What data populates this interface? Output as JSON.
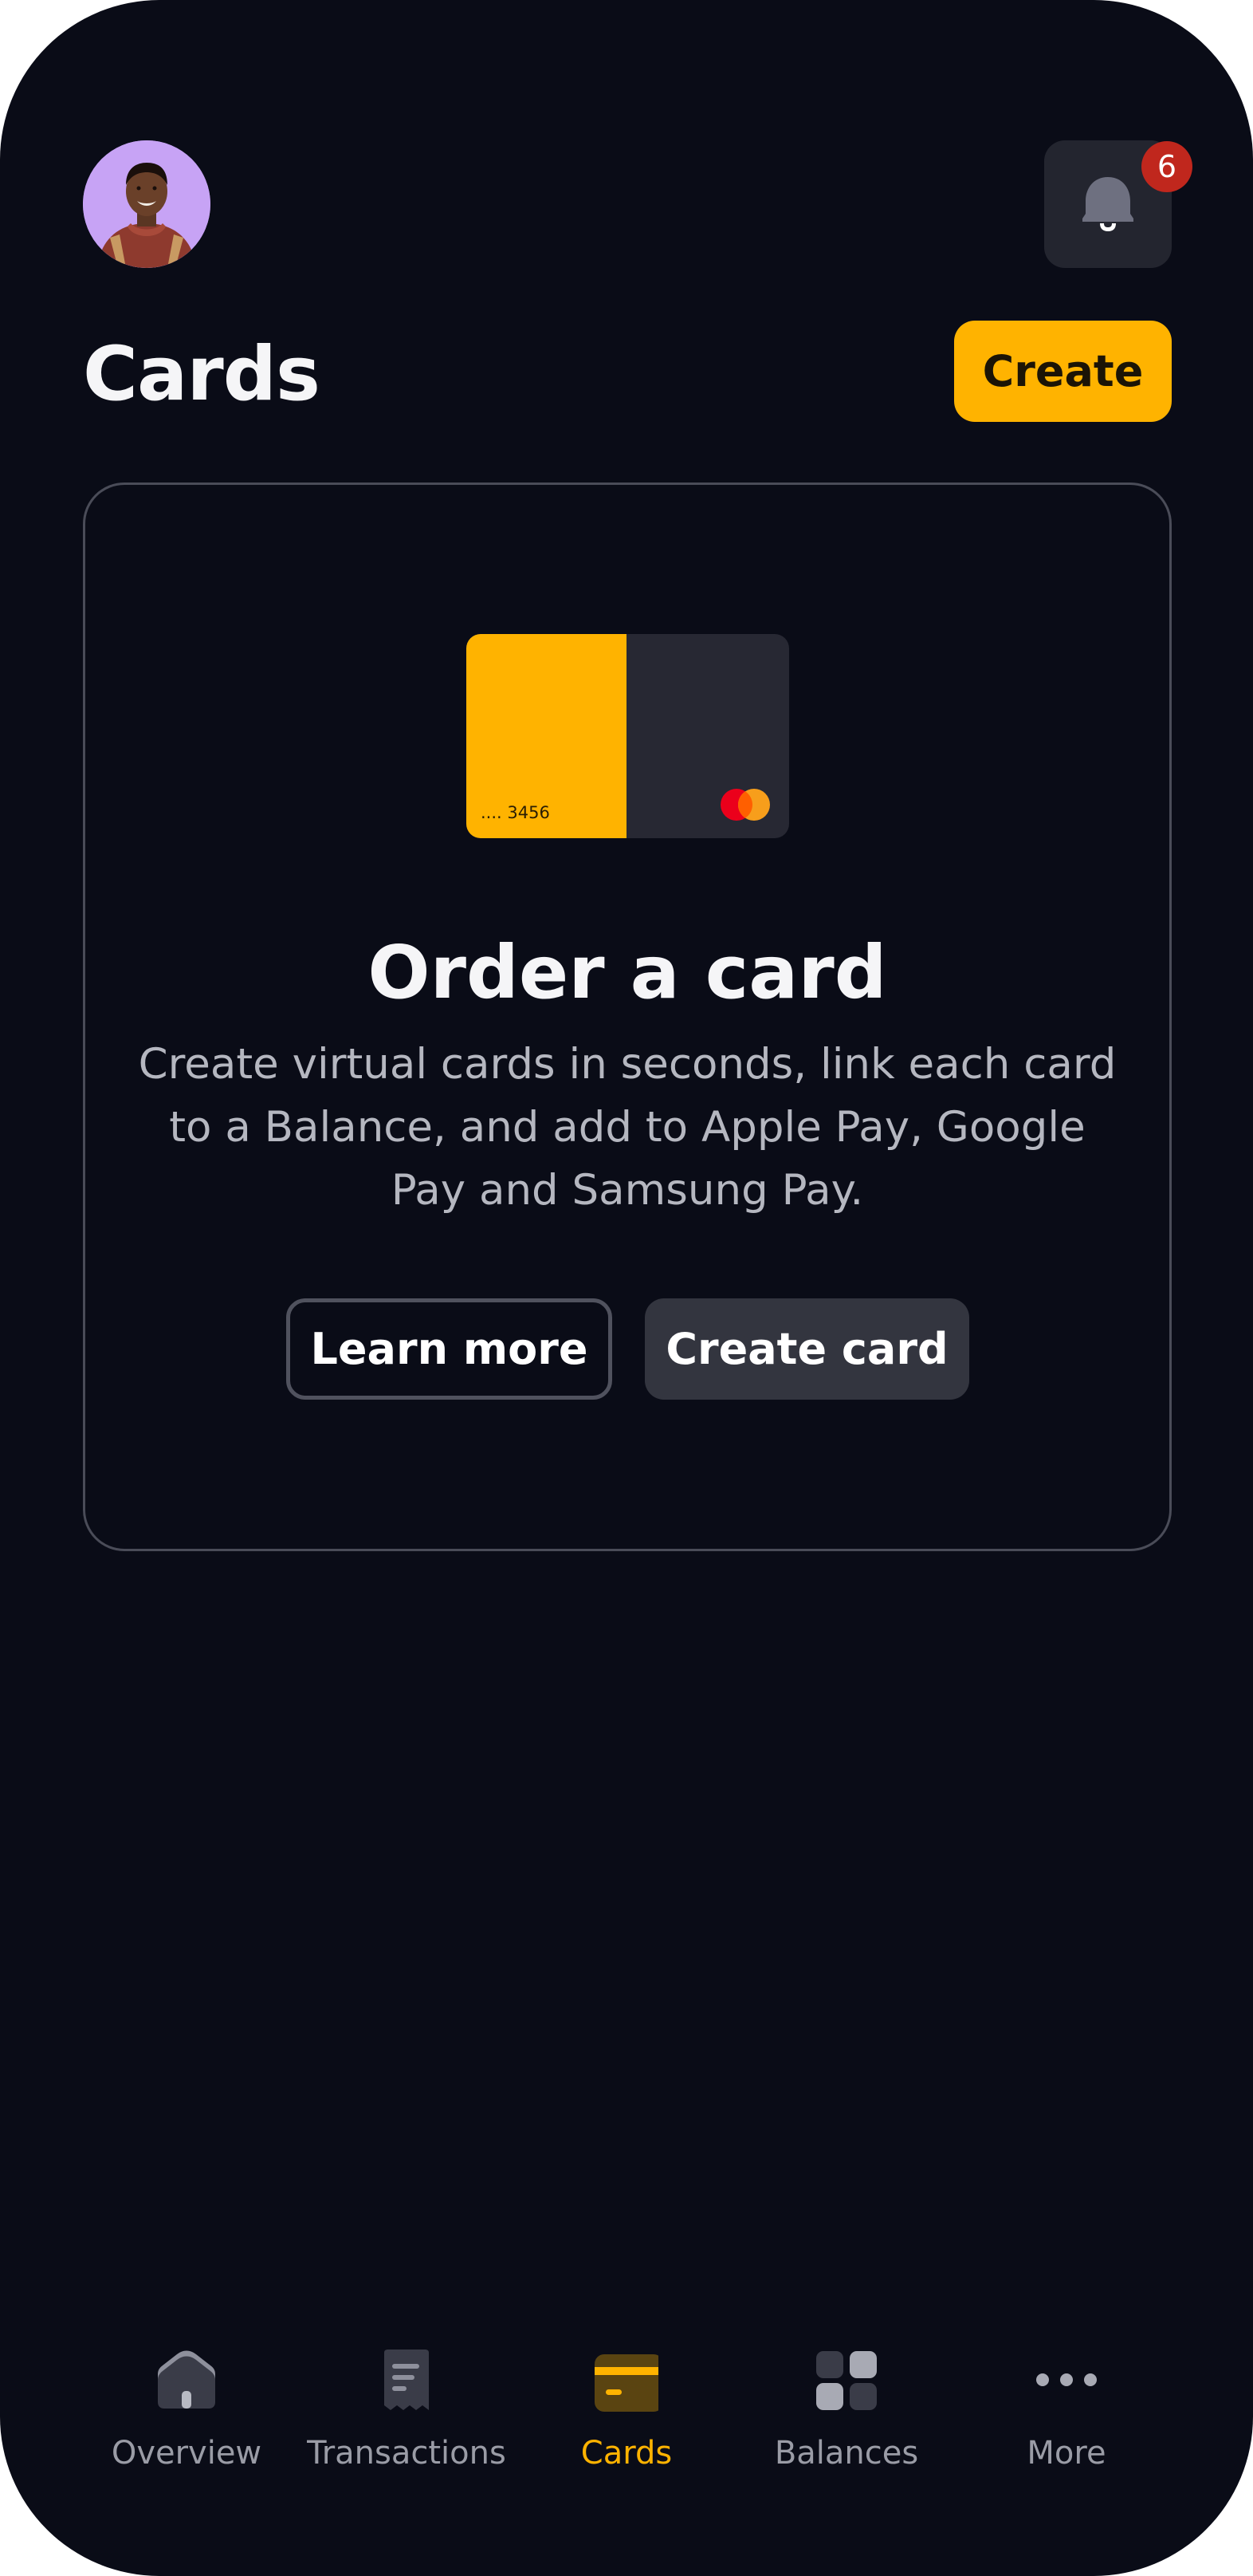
{
  "header": {
    "notifications_count": "6"
  },
  "page": {
    "title": "Cards",
    "create_label": "Create"
  },
  "promo": {
    "card_number": ".... 3456",
    "heading": "Order a card",
    "description": "Create virtual cards in seconds, link each card to a Balance, and add to Apple Pay, Google Pay and Samsung Pay.",
    "learn_more_label": "Learn more",
    "create_card_label": "Create card"
  },
  "bottom_nav": {
    "items": [
      {
        "label": "Overview",
        "icon": "home-icon",
        "active": false
      },
      {
        "label": "Transactions",
        "icon": "receipt-icon",
        "active": false
      },
      {
        "label": "Cards",
        "icon": "card-icon",
        "active": true
      },
      {
        "label": "Balances",
        "icon": "grid-icon",
        "active": false
      },
      {
        "label": "More",
        "icon": "more-dots-icon",
        "active": false
      }
    ]
  },
  "colors": {
    "background": "#0a0c17",
    "accent": "#ffb300",
    "badge": "#c0271d",
    "surface": "#23252f",
    "muted_text": "#9a9ca6"
  }
}
